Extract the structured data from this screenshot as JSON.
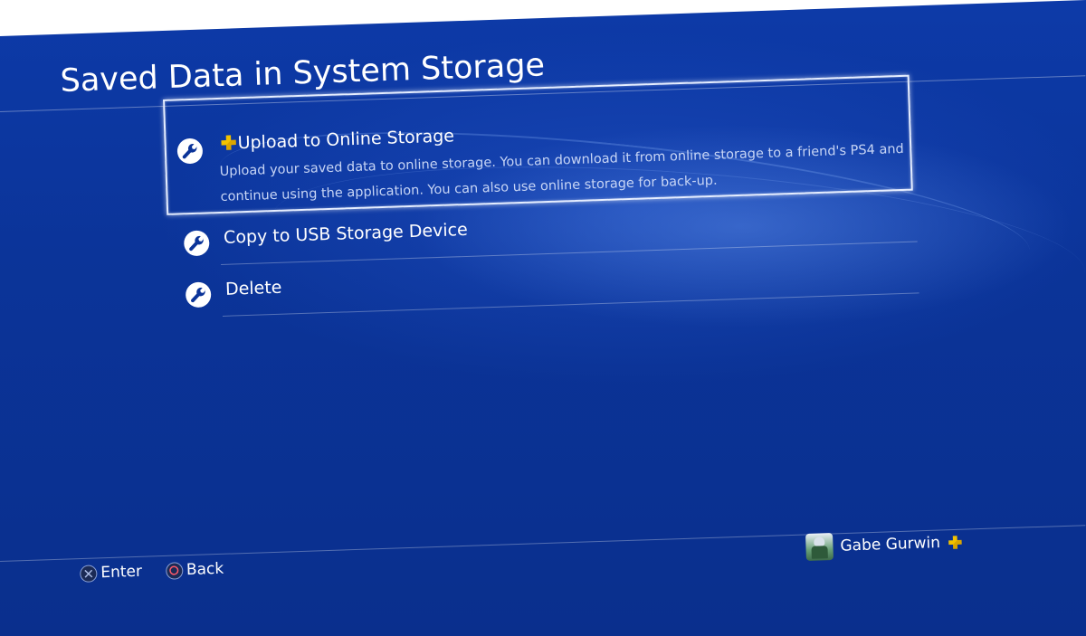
{
  "screen": {
    "title": "Saved Data in System Storage"
  },
  "menu": {
    "items": [
      {
        "label": "Upload to Online Storage",
        "description": "Upload your saved data to online storage. You can download it from online storage to a friend's PS4 and continue using the application. You can also use online storage for back-up.",
        "icon": "wrench-icon",
        "badge": "ps-plus-icon",
        "selected": true
      },
      {
        "label": "Copy to USB Storage Device",
        "icon": "wrench-icon",
        "selected": false
      },
      {
        "label": "Delete",
        "icon": "wrench-icon",
        "selected": false
      }
    ]
  },
  "footer": {
    "enter_label": "Enter",
    "back_label": "Back",
    "enter_icon": "cross-button-icon",
    "back_icon": "circle-button-icon"
  },
  "user": {
    "name": "Gabe Gurwin",
    "badge": "ps-plus-icon"
  },
  "colors": {
    "background": "#0b3499",
    "selection_border": "#e6eeff",
    "plus_gold": "#f2c200",
    "text": "#ffffff",
    "description_text": "#c7d5f5"
  }
}
